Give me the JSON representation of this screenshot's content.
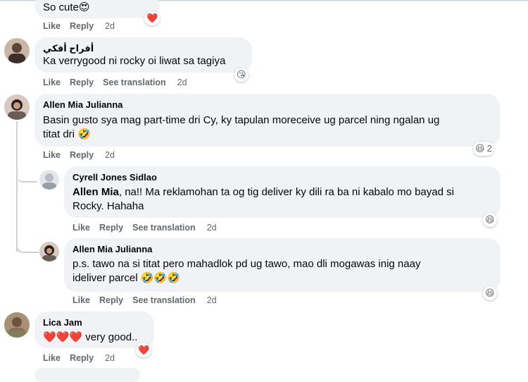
{
  "common": {
    "like": "Like",
    "reply": "Reply",
    "see_translation": "See translation"
  },
  "comments": [
    {
      "text": "So cute😍",
      "time": "2d",
      "reaction": "❤️"
    },
    {
      "name": "أفراح أفكي",
      "text": "Ka verrygood ni rocky oi liwat sa tagiya",
      "time": "2d",
      "reaction": "😘"
    },
    {
      "name": "Allen Mia Julianna",
      "text_line1": "Basin gusto sya mag part-time dri Cy, ky tapulan moreceive ug parcel ning ngalan ug",
      "text_line2": "titat dri 🤣",
      "time": "2d",
      "reaction": "😆",
      "reaction_count": "2"
    },
    {
      "name": "Cyrell Jones Sidlao",
      "mention": "Allen Mia",
      "text_line1": ", na!! Ma reklamohan ta og tig deliver ky dili ra ba ni kabalo mo bayad si",
      "text_line2": "Rocky. Hahaha",
      "time": "2d",
      "reaction": "😆"
    },
    {
      "name": "Allen Mia Julianna",
      "text_line1": "p.s. tawo na si titat pero mahadlok pd ug tawo, mao dli mogawas inig naay",
      "text_line2": "ideliver parcel 🤣🤣🤣",
      "time": "2d",
      "reaction": "😆"
    },
    {
      "name": "Lica Jam",
      "text": "❤️❤️❤️ very good..",
      "time": "2d",
      "reaction": "❤️"
    }
  ]
}
